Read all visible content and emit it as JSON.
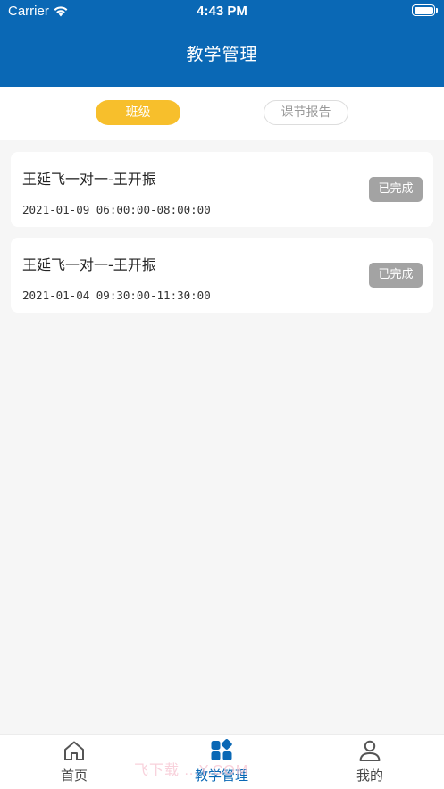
{
  "status_bar": {
    "carrier": "Carrier",
    "time": "4:43 PM"
  },
  "header": {
    "title": "教学管理"
  },
  "segments": [
    {
      "label": "班级",
      "selected": true
    },
    {
      "label": "课节报告",
      "selected": false
    }
  ],
  "classes": [
    {
      "title": "王延飞一对一-王开振",
      "time": "2021-01-09 06:00:00-08:00:00",
      "status": "已完成"
    },
    {
      "title": "王延飞一对一-王开振",
      "time": "2021-01-04 09:30:00-11:30:00",
      "status": "已完成"
    }
  ],
  "tabbar": {
    "items": [
      {
        "label": "首页",
        "icon": "home-icon"
      },
      {
        "label": "教学管理",
        "icon": "grid-icon",
        "active": true
      },
      {
        "label": "我的",
        "icon": "person-icon"
      }
    ]
  },
  "watermark": "飞下载 ...Y.COM",
  "colors": {
    "primary": "#0a68b5",
    "accent": "#f7bf2c",
    "badge": "#a3a3a3",
    "background": "#f6f6f6"
  }
}
